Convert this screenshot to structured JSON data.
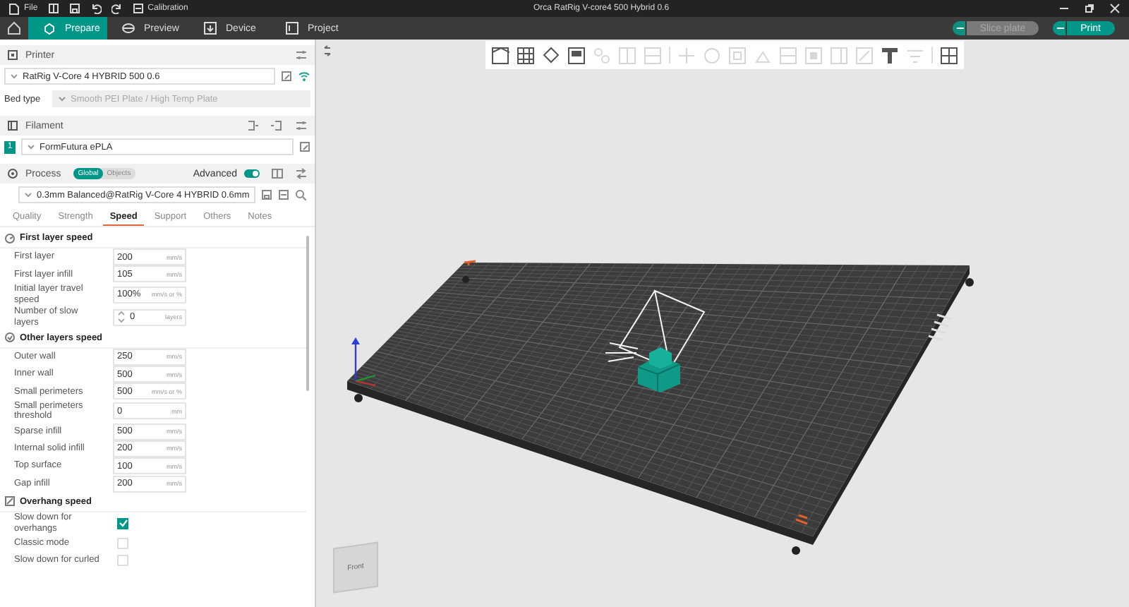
{
  "title_bar": {
    "menu": "File",
    "calibration": "Calibration",
    "title": "Orca RatRig V-core4 500 Hybrid 0.6"
  },
  "tabs": [
    {
      "label": "Prepare",
      "selected": true
    },
    {
      "label": "Preview",
      "selected": false
    },
    {
      "label": "Device",
      "selected": false
    },
    {
      "label": "Project",
      "selected": false
    }
  ],
  "actions": [
    {
      "label": "Slice plate",
      "disabled": true
    },
    {
      "label": "Print",
      "disabled": false
    }
  ],
  "printer": {
    "title": "Printer",
    "preset": "RatRig V-Core 4 HYBRID 500 0.6",
    "bed_type_label": "Bed type",
    "bed_type": "Smooth PEI Plate / High Temp Plate"
  },
  "filament": {
    "title": "Filament",
    "slots": [
      {
        "number": "1",
        "name": "FormFutura ePLA",
        "color": "#009688"
      }
    ]
  },
  "process": {
    "title": "Process",
    "scope": [
      {
        "label": "Global",
        "selected": true
      },
      {
        "label": "Objects",
        "selected": false
      }
    ],
    "advanced_label": "Advanced",
    "advanced": true,
    "preset": "0.3mm Balanced@RatRig V-Core 4 HYBRID 0.6mm"
  },
  "settings_tabs": [
    {
      "label": "Quality",
      "selected": false
    },
    {
      "label": "Strength",
      "selected": false
    },
    {
      "label": "Speed",
      "selected": true
    },
    {
      "label": "Support",
      "selected": false
    },
    {
      "label": "Others",
      "selected": false
    },
    {
      "label": "Notes",
      "selected": false
    }
  ],
  "groups": [
    {
      "title": "First layer speed",
      "items": [
        {
          "kind": "input",
          "label": "First layer",
          "value": "200",
          "unit": "mm/s"
        },
        {
          "kind": "input",
          "label": "First layer infill",
          "value": "105",
          "unit": "mm/s"
        },
        {
          "kind": "input",
          "label": "Initial layer travel speed",
          "value": "100%",
          "unit": "mm/s or %"
        },
        {
          "kind": "spin",
          "label": "Number of slow layers",
          "value": "0",
          "unit": "layers"
        }
      ]
    },
    {
      "title": "Other layers speed",
      "items": [
        {
          "kind": "input",
          "label": "Outer wall",
          "value": "250",
          "unit": "mm/s"
        },
        {
          "kind": "input",
          "label": "Inner wall",
          "value": "500",
          "unit": "mm/s"
        },
        {
          "kind": "input",
          "label": "Small perimeters",
          "value": "500",
          "unit": "mm/s or %"
        },
        {
          "kind": "input",
          "label": "Small perimeters threshold",
          "value": "0",
          "unit": "mm"
        },
        {
          "kind": "input",
          "label": "Sparse infill",
          "value": "500",
          "unit": "mm/s"
        },
        {
          "kind": "input",
          "label": "Internal solid infill",
          "value": "200",
          "unit": "mm/s"
        },
        {
          "kind": "input",
          "label": "Top surface",
          "value": "100",
          "unit": "mm/s"
        },
        {
          "kind": "input",
          "label": "Gap infill",
          "value": "200",
          "unit": "mm/s"
        }
      ]
    },
    {
      "title": "Overhang speed",
      "items": [
        {
          "kind": "checkbox",
          "label": "Slow down for overhangs",
          "checked": true
        },
        {
          "kind": "checkbox",
          "label": "Classic mode",
          "checked": false
        },
        {
          "kind": "checkbox",
          "label": "Slow down for curled",
          "checked": false
        }
      ]
    }
  ],
  "toolbar": [
    {
      "disabled": false
    },
    {
      "disabled": false
    },
    {
      "disabled": false
    },
    {
      "disabled": false
    },
    {
      "disabled": true
    },
    {
      "disabled": true
    },
    {
      "disabled": true
    },
    {
      "disabled": true
    },
    {
      "disabled": true
    },
    {
      "disabled": true
    },
    {
      "disabled": true
    },
    {
      "disabled": true
    },
    {
      "disabled": true
    },
    {
      "disabled": true
    },
    {
      "disabled": true
    },
    {
      "disabled": false
    },
    {
      "disabled": true
    },
    {
      "disabled": false
    }
  ],
  "nav_cube": {
    "face": "Front"
  }
}
